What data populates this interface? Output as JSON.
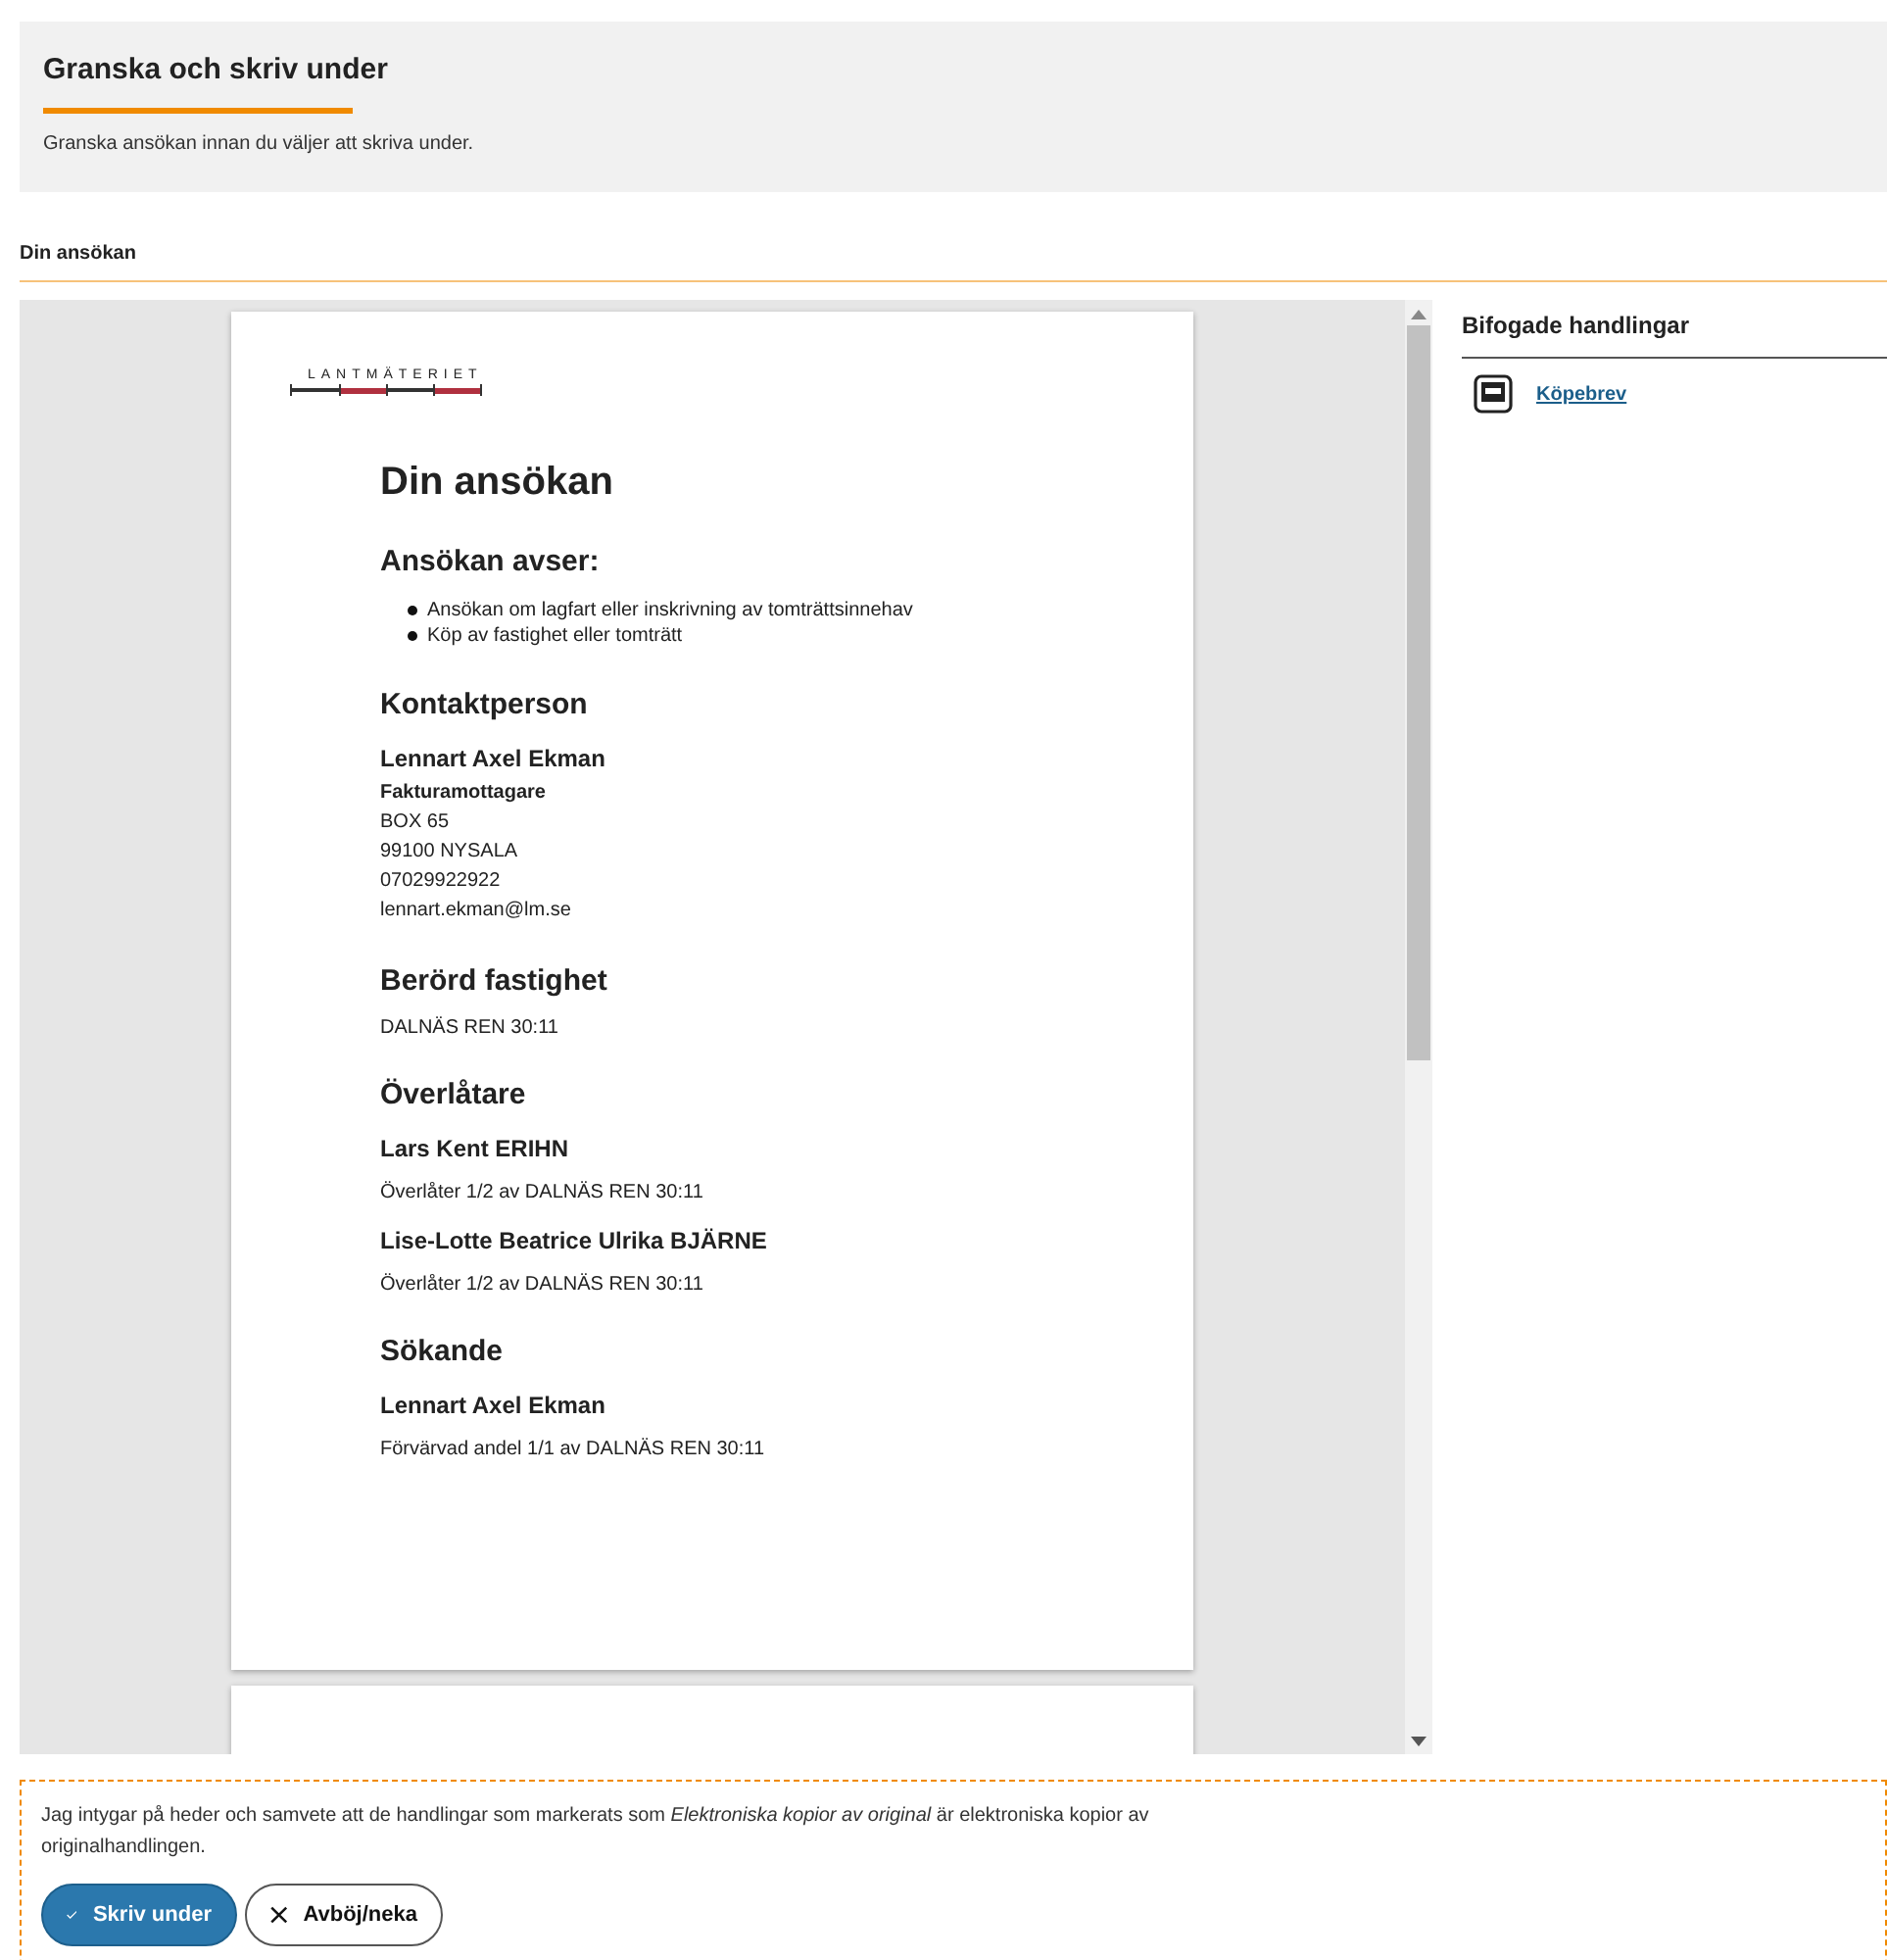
{
  "header": {
    "title": "Granska och skriv under",
    "subtitle": "Granska ansökan innan du väljer att skriva under."
  },
  "section_label": "Din ansökan",
  "document": {
    "logo": "LANTMÄTERIET",
    "title": "Din ansökan",
    "sections": [
      {
        "heading": "Ansökan avser:",
        "blocks": [
          {
            "kind": "bullets",
            "items": [
              "Ansökan om lagfart eller inskrivning av tomträttsinnehav",
              "Köp av fastighet eller tomträtt"
            ]
          }
        ]
      },
      {
        "heading": "Kontaktperson",
        "blocks": [
          {
            "kind": "person",
            "name": "Lennart Axel Ekman",
            "lines": [
              {
                "text": "Fakturamottagare",
                "bold": true
              },
              {
                "text": "BOX 65",
                "bold": false
              },
              {
                "text": "99100 NYSALA",
                "bold": false
              },
              {
                "text": "07029922922",
                "bold": false
              },
              {
                "text": "lennart.ekman@lm.se",
                "bold": false
              }
            ]
          }
        ]
      },
      {
        "heading": "Berörd fastighet",
        "blocks": [
          {
            "kind": "text",
            "text": "DALNÄS REN 30:11"
          }
        ]
      },
      {
        "heading": "Överlåtare",
        "blocks": [
          {
            "kind": "person",
            "name": "Lars Kent ERIHN"
          },
          {
            "kind": "text",
            "text": "Överlåter 1/2 av DALNÄS REN 30:11"
          },
          {
            "kind": "person",
            "name": "Lise-Lotte Beatrice Ulrika BJÄRNE"
          },
          {
            "kind": "text",
            "text": "Överlåter 1/2 av DALNÄS REN 30:11"
          }
        ]
      },
      {
        "heading": "Sökande",
        "blocks": [
          {
            "kind": "person",
            "name": "Lennart Axel Ekman"
          },
          {
            "kind": "text",
            "text": "Förvärvad andel 1/1 av DALNÄS REN 30:11"
          }
        ]
      }
    ]
  },
  "attachments": {
    "title": "Bifogade handlingar",
    "items": [
      {
        "label": "Köpebrev"
      }
    ]
  },
  "confirmation": {
    "text": "Jag intygar på heder och samvete att de handlingar som markerats som *Elektroniska kopior av original* är elektroniska kopior av originalhandlingen.",
    "buttons": [
      {
        "kind": "primary",
        "label": "Skriv under"
      },
      {
        "kind": "secondary",
        "label": "Avböj/neka"
      }
    ]
  }
}
